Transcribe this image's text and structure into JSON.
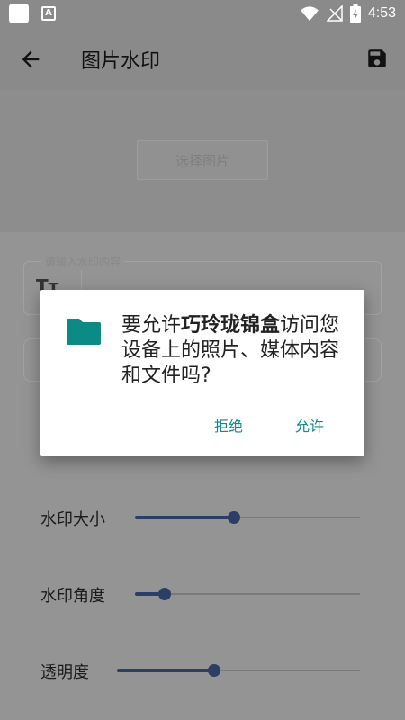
{
  "status_bar": {
    "time": "4:53",
    "icons": [
      "app-square-icon",
      "a-notification-icon",
      "wifi-icon",
      "no-signal-icon",
      "battery-charging-icon"
    ]
  },
  "app_bar": {
    "title": "图片水印",
    "back_icon": "arrow-left-icon",
    "save_icon": "save-icon"
  },
  "pick_button": {
    "label": "选择图片"
  },
  "watermark_input": {
    "label": "请输入水印内容",
    "icon": "text-size-icon"
  },
  "sliders": [
    {
      "label": "水印大小",
      "value": 0.44
    },
    {
      "label": "水印角度",
      "value": 0.13
    },
    {
      "label": "透明度",
      "value": 0.4
    }
  ],
  "dialog": {
    "msg_prefix": "要允许",
    "app_name": "巧玲珑锦盒",
    "msg_suffix": "访问您设备上的照片、媒体内容和文件吗?",
    "deny_label": "拒绝",
    "allow_label": "允许",
    "icon": "folder-icon"
  },
  "colors": {
    "accent": "#0b8a86",
    "slider": "#2b3f66"
  }
}
